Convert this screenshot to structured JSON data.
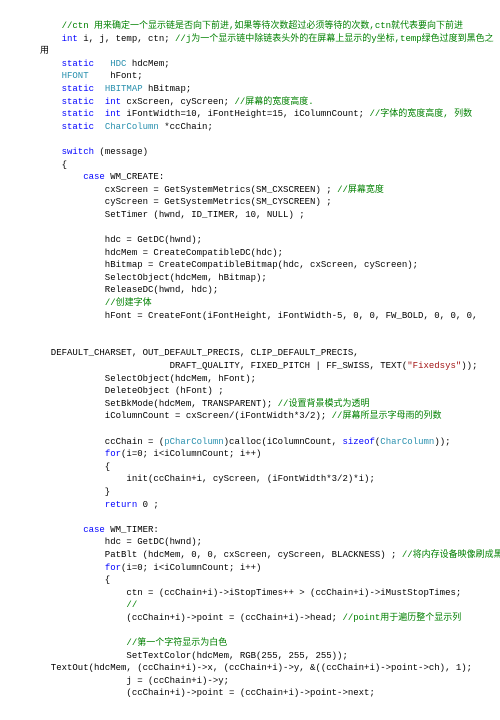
{
  "lines": [
    {
      "indent": 1,
      "segs": [
        [
          "g",
          "//ctn 用来确定一个显示链是否向下前进,如果等待次数超过必须等待的次数,ctn就代表要向下前进"
        ]
      ]
    },
    {
      "indent": 1,
      "segs": [
        [
          "b",
          "int"
        ],
        [
          "",
          " i, j, temp, ctn; "
        ],
        [
          "g",
          "//j为一个显示链中除链表头外的在屏幕上显示的y坐标,temp绿色过度到黑色之"
        ]
      ]
    },
    {
      "indent": 0,
      "segs": [
        [
          "",
          "用"
        ]
      ]
    },
    {
      "indent": 1,
      "segs": [
        [
          "b",
          "static"
        ],
        [
          "",
          "   "
        ],
        [
          "t",
          "HDC"
        ],
        [
          "",
          " hdcMem;"
        ]
      ]
    },
    {
      "indent": 1,
      "segs": [
        [
          "t",
          "HFONT"
        ],
        [
          "",
          "    hFont;"
        ]
      ]
    },
    {
      "indent": 1,
      "segs": [
        [
          "b",
          "static"
        ],
        [
          "",
          "  "
        ],
        [
          "t",
          "HBITMAP"
        ],
        [
          "",
          " hBitmap;"
        ]
      ]
    },
    {
      "indent": 1,
      "segs": [
        [
          "b",
          "static"
        ],
        [
          "",
          "  "
        ],
        [
          "b",
          "int"
        ],
        [
          "",
          " cxScreen, cyScreen; "
        ],
        [
          "g",
          "//屏幕的宽度高度."
        ]
      ]
    },
    {
      "indent": 1,
      "segs": [
        [
          "b",
          "static"
        ],
        [
          "",
          "  "
        ],
        [
          "b",
          "int"
        ],
        [
          "",
          " iFontWidth=10, iFontHeight=15, iColumnCount; "
        ],
        [
          "g",
          "//字体的宽度高度, 列数"
        ]
      ]
    },
    {
      "indent": 1,
      "segs": [
        [
          "b",
          "static"
        ],
        [
          "",
          "  "
        ],
        [
          "t",
          "CharColumn"
        ],
        [
          "",
          " *ccChain;"
        ]
      ]
    },
    {
      "indent": 1,
      "segs": [
        [
          "",
          ""
        ]
      ]
    },
    {
      "indent": 1,
      "segs": [
        [
          "b",
          "switch"
        ],
        [
          "",
          " (message)"
        ]
      ]
    },
    {
      "indent": 1,
      "segs": [
        [
          "",
          "{"
        ]
      ]
    },
    {
      "indent": 2,
      "segs": [
        [
          "b",
          "case"
        ],
        [
          "",
          " WM_CREATE:"
        ]
      ]
    },
    {
      "indent": 3,
      "segs": [
        [
          "",
          "cxScreen = GetSystemMetrics(SM_CXSCREEN) ; "
        ],
        [
          "g",
          "//屏幕宽度"
        ]
      ]
    },
    {
      "indent": 3,
      "segs": [
        [
          "",
          "cyScreen = GetSystemMetrics(SM_CYSCREEN) ;"
        ]
      ]
    },
    {
      "indent": 3,
      "segs": [
        [
          "",
          "SetTimer (hwnd, ID_TIMER, 10, NULL) ;"
        ]
      ]
    },
    {
      "indent": 3,
      "segs": [
        [
          "",
          ""
        ]
      ]
    },
    {
      "indent": 3,
      "segs": [
        [
          "",
          "hdc = GetDC(hwnd);"
        ]
      ]
    },
    {
      "indent": 3,
      "segs": [
        [
          "",
          "hdcMem = CreateCompatibleDC(hdc);"
        ]
      ]
    },
    {
      "indent": 3,
      "segs": [
        [
          "",
          "hBitmap = CreateCompatibleBitmap(hdc, cxScreen, cyScreen);"
        ]
      ]
    },
    {
      "indent": 3,
      "segs": [
        [
          "",
          "SelectObject(hdcMem, hBitmap);"
        ]
      ]
    },
    {
      "indent": 3,
      "segs": [
        [
          "",
          "ReleaseDC(hwnd, hdc);"
        ]
      ]
    },
    {
      "indent": 3,
      "segs": [
        [
          "g",
          "//创建字体"
        ]
      ]
    },
    {
      "indent": 3,
      "segs": [
        [
          "",
          "hFont = CreateFont(iFontHeight, iFontWidth-5, 0, 0, FW_BOLD, 0, 0, 0,"
        ]
      ]
    },
    {
      "indent": 1,
      "segs": [
        [
          "",
          ""
        ]
      ]
    },
    {
      "indent": 1,
      "segs": [
        [
          "",
          ""
        ]
      ]
    },
    {
      "indent": 0,
      "segs": [
        [
          "",
          "  DEFAULT_CHARSET, OUT_DEFAULT_PRECIS, CLIP_DEFAULT_PRECIS,"
        ]
      ]
    },
    {
      "indent": 5,
      "segs": [
        [
          "",
          "DRAFT_QUALITY, FIXED_PITCH | FF_SWISS, TEXT("
        ],
        [
          "r",
          "\"Fixedsys\""
        ],
        [
          "",
          "));"
        ]
      ]
    },
    {
      "indent": 3,
      "segs": [
        [
          "",
          "SelectObject(hdcMem, hFont);"
        ]
      ]
    },
    {
      "indent": 3,
      "segs": [
        [
          "",
          "DeleteObject (hFont) ;"
        ]
      ]
    },
    {
      "indent": 3,
      "segs": [
        [
          "",
          "SetBkMode(hdcMem, TRANSPARENT); "
        ],
        [
          "g",
          "//设置背景模式为透明"
        ]
      ]
    },
    {
      "indent": 3,
      "segs": [
        [
          "",
          "iColumnCount = cxScreen/(iFontWidth*3/2); "
        ],
        [
          "g",
          "//屏幕所显示字母雨的列数"
        ]
      ]
    },
    {
      "indent": 3,
      "segs": [
        [
          "",
          ""
        ]
      ]
    },
    {
      "indent": 3,
      "segs": [
        [
          "",
          "ccChain = ("
        ],
        [
          "t",
          "pCharColumn"
        ],
        [
          "",
          ")calloc(iColumnCount, "
        ],
        [
          "b",
          "sizeof"
        ],
        [
          "",
          "("
        ],
        [
          "t",
          "CharColumn"
        ],
        [
          "",
          "));"
        ]
      ]
    },
    {
      "indent": 3,
      "segs": [
        [
          "b",
          "for"
        ],
        [
          "",
          "(i=0; i<iColumnCount; i++)"
        ]
      ]
    },
    {
      "indent": 3,
      "segs": [
        [
          "",
          "{"
        ]
      ]
    },
    {
      "indent": 4,
      "segs": [
        [
          "",
          "init(ccChain+i, cyScreen, (iFontWidth*3/2)*i);"
        ]
      ]
    },
    {
      "indent": 3,
      "segs": [
        [
          "",
          "}"
        ]
      ]
    },
    {
      "indent": 3,
      "segs": [
        [
          "b",
          "return"
        ],
        [
          "",
          " 0 ;"
        ]
      ]
    },
    {
      "indent": 1,
      "segs": [
        [
          "",
          ""
        ]
      ]
    },
    {
      "indent": 2,
      "segs": [
        [
          "b",
          "case"
        ],
        [
          "",
          " WM_TIMER:"
        ]
      ]
    },
    {
      "indent": 3,
      "segs": [
        [
          "",
          "hdc = GetDC(hwnd);"
        ]
      ]
    },
    {
      "indent": 3,
      "segs": [
        [
          "",
          "PatBlt (hdcMem, 0, 0, cxScreen, cyScreen, BLACKNESS) ; "
        ],
        [
          "g",
          "//将内存设备映像刷成黑色"
        ]
      ]
    },
    {
      "indent": 3,
      "segs": [
        [
          "b",
          "for"
        ],
        [
          "",
          "(i=0; i<iColumnCount; i++)"
        ]
      ]
    },
    {
      "indent": 3,
      "segs": [
        [
          "",
          "{"
        ]
      ]
    },
    {
      "indent": 4,
      "segs": [
        [
          "",
          "ctn = (ccChain+i)->iStopTimes++ > (ccChain+i)->iMustStopTimes;"
        ]
      ]
    },
    {
      "indent": 4,
      "segs": [
        [
          "g",
          "//"
        ]
      ]
    },
    {
      "indent": 4,
      "segs": [
        [
          "",
          "(ccChain+i)->point = (ccChain+i)->head; "
        ],
        [
          "g",
          "//point用于遍历整个显示列"
        ]
      ]
    },
    {
      "indent": 4,
      "segs": [
        [
          "",
          ""
        ]
      ]
    },
    {
      "indent": 4,
      "segs": [
        [
          "g",
          "//第一个字符显示为白色"
        ]
      ]
    },
    {
      "indent": 4,
      "segs": [
        [
          "",
          "SetTextColor(hdcMem, RGB(255, 255, 255));"
        ]
      ]
    },
    {
      "indent": 0,
      "segs": [
        [
          "",
          "  TextOut(hdcMem, (ccChain+i)->x, (ccChain+i)->y, &((ccChain+i)->point->ch), 1);"
        ]
      ]
    },
    {
      "indent": 4,
      "segs": [
        [
          "",
          "j = (ccChain+i)->y;"
        ]
      ]
    },
    {
      "indent": 4,
      "segs": [
        [
          "",
          "(ccChain+i)->point = (ccChain+i)->point->next;"
        ]
      ]
    }
  ],
  "chart_data": null
}
